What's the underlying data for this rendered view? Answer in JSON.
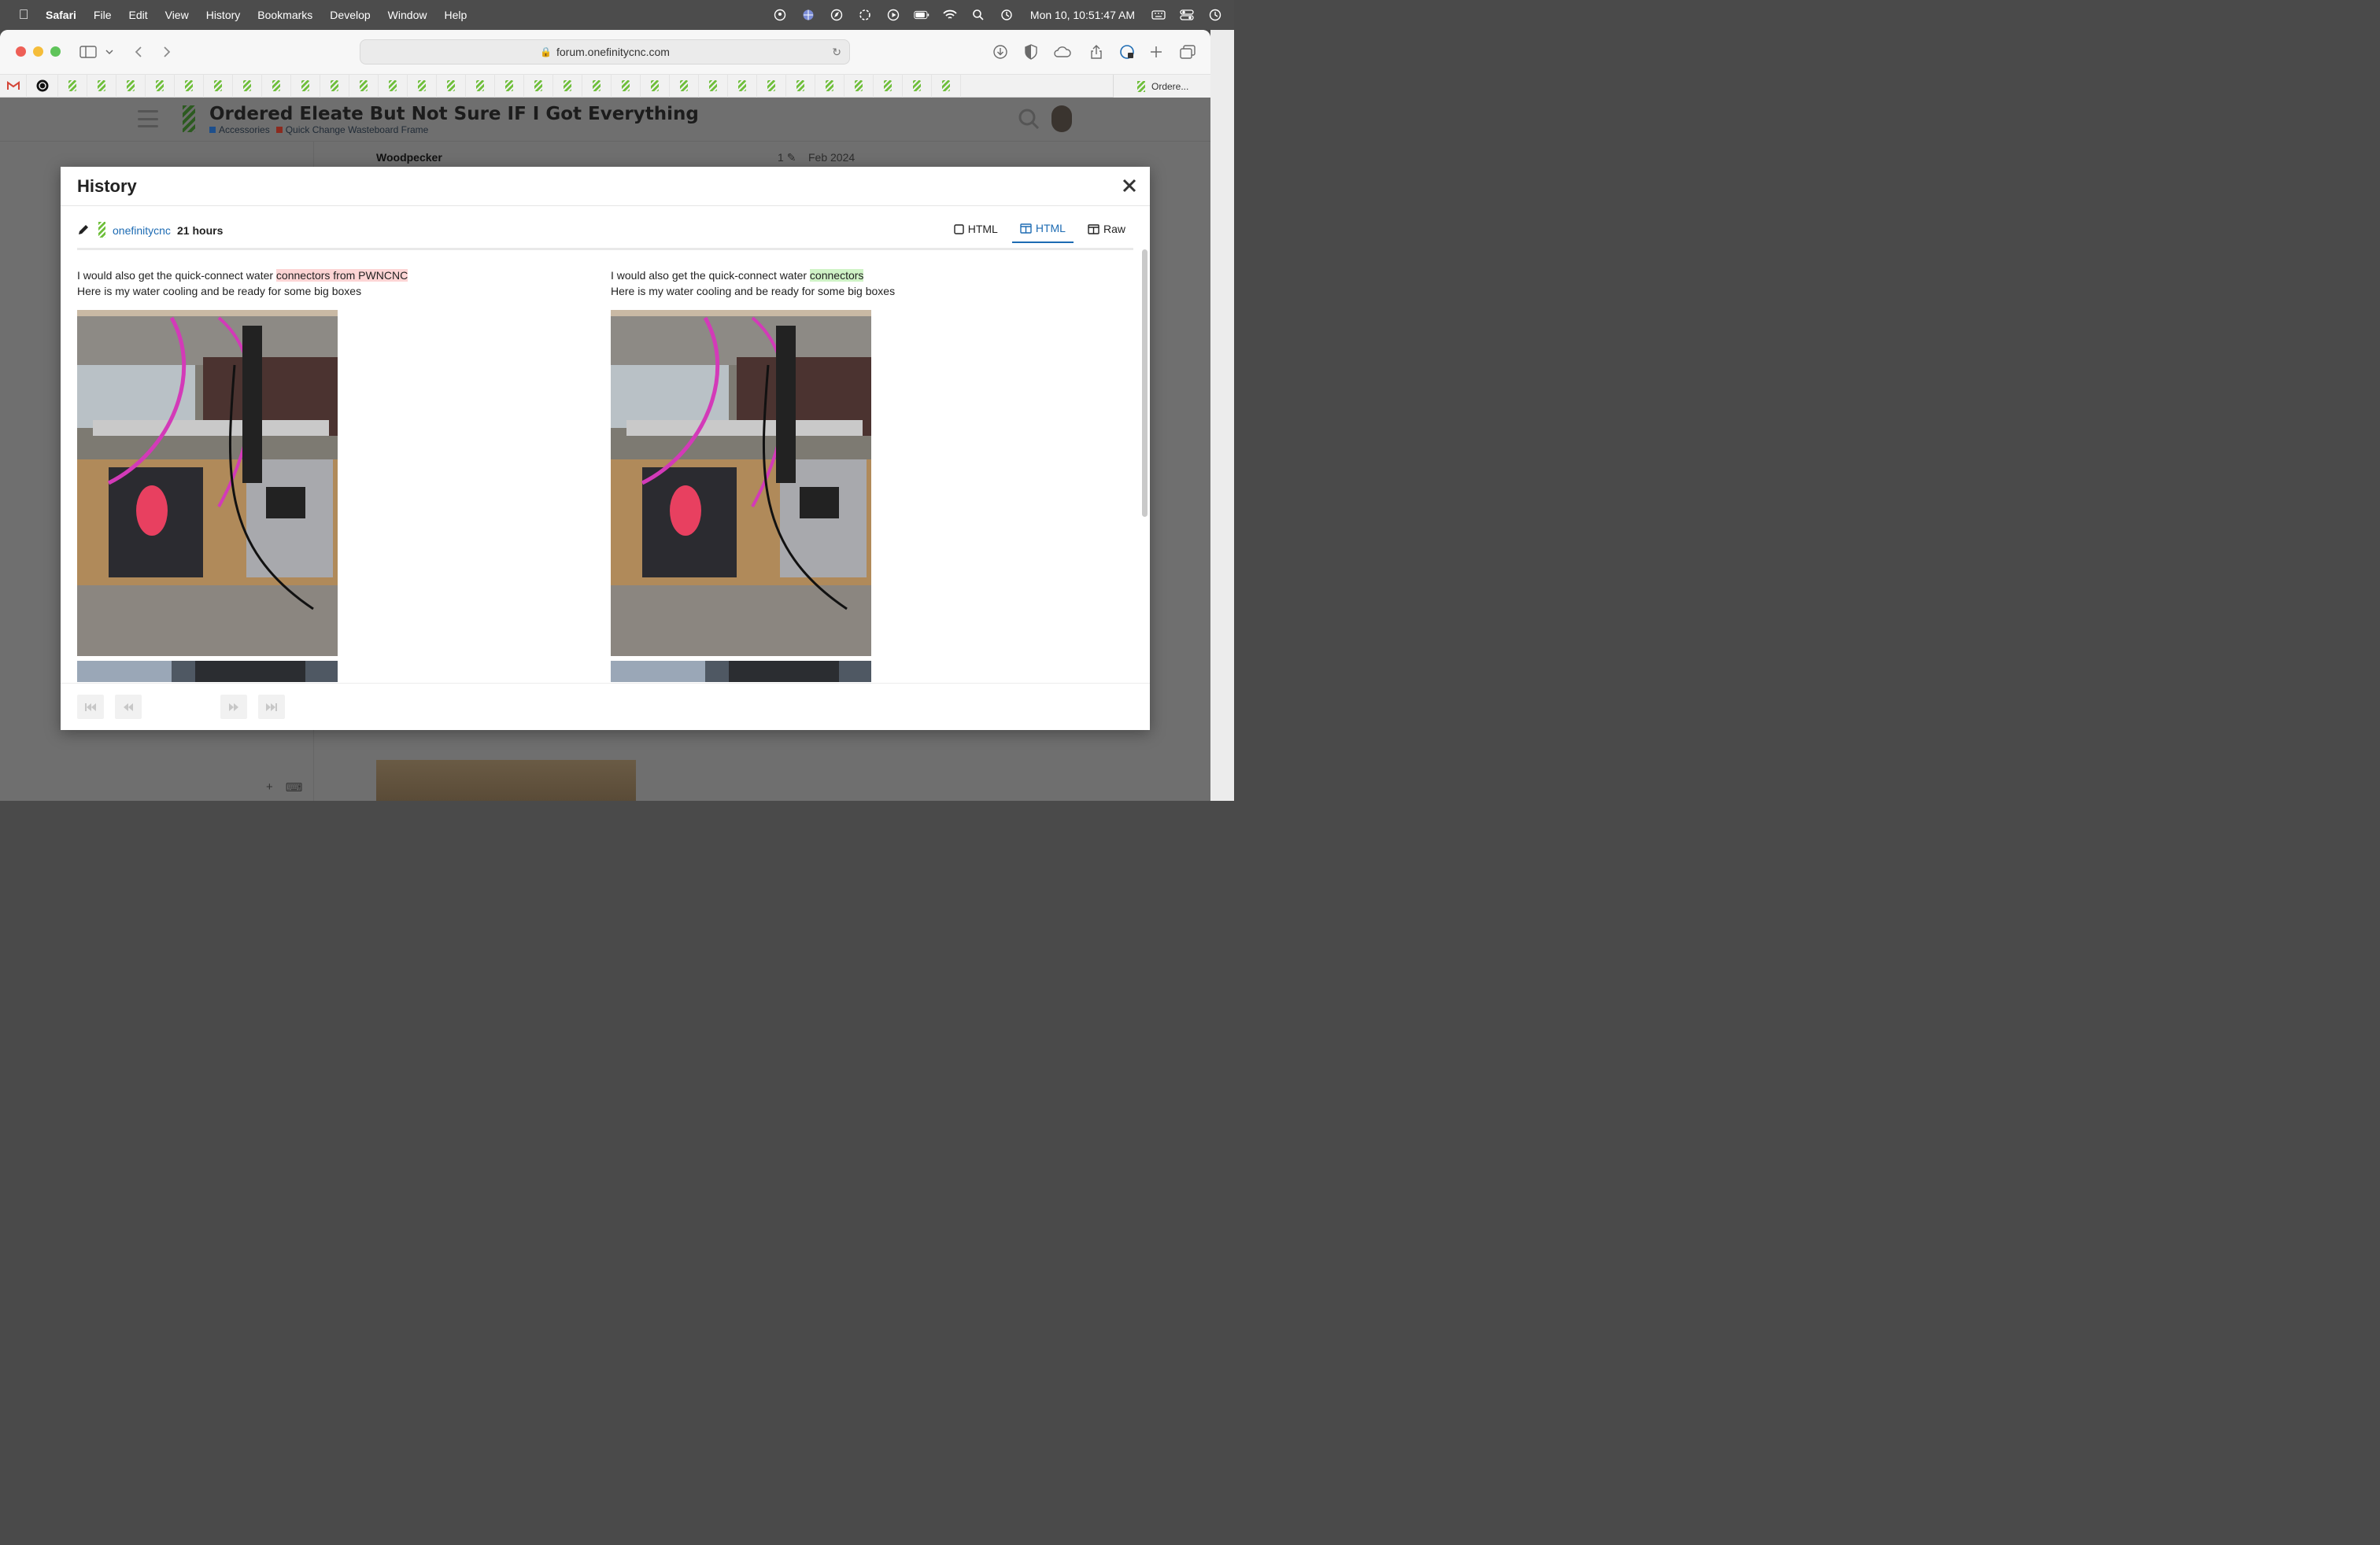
{
  "menubar": {
    "app": "Safari",
    "items": [
      "File",
      "Edit",
      "View",
      "History",
      "Bookmarks",
      "Develop",
      "Window",
      "Help"
    ],
    "clock": "Mon 10, 10:51:47 AM"
  },
  "browser": {
    "url": "forum.onefinitycnc.com",
    "active_tab": "Ordere..."
  },
  "page": {
    "title": "Ordered Eleate But Not Sure IF I Got Everything",
    "categories": [
      {
        "label": "Accessories",
        "color": "#1e4f8c"
      },
      {
        "label": "Quick Change Wasteboard Frame",
        "color": "#8c2a1e"
      }
    ],
    "poster": "Woodpecker",
    "edit_count": "1",
    "date": "Feb 2024"
  },
  "modal": {
    "title": "History",
    "revision": {
      "user": "onefinitycnc",
      "time": "21 hours"
    },
    "view_tabs": [
      {
        "label": "HTML",
        "icon": "checkbox-icon",
        "active": false
      },
      {
        "label": "HTML",
        "icon": "split-view-icon",
        "active": true
      },
      {
        "label": "Raw",
        "icon": "split-view-icon",
        "active": false
      }
    ],
    "left": {
      "line1_prefix": "I would also get the quick-connect water ",
      "line1_deleted": "connectors from PWNCNC",
      "line2": "Here is my water cooling and be ready for some big boxes"
    },
    "right": {
      "line1_prefix": "I would also get the quick-connect water ",
      "line1_inserted": "connectors",
      "line2": "Here is my water cooling and be ready for some big boxes"
    }
  }
}
